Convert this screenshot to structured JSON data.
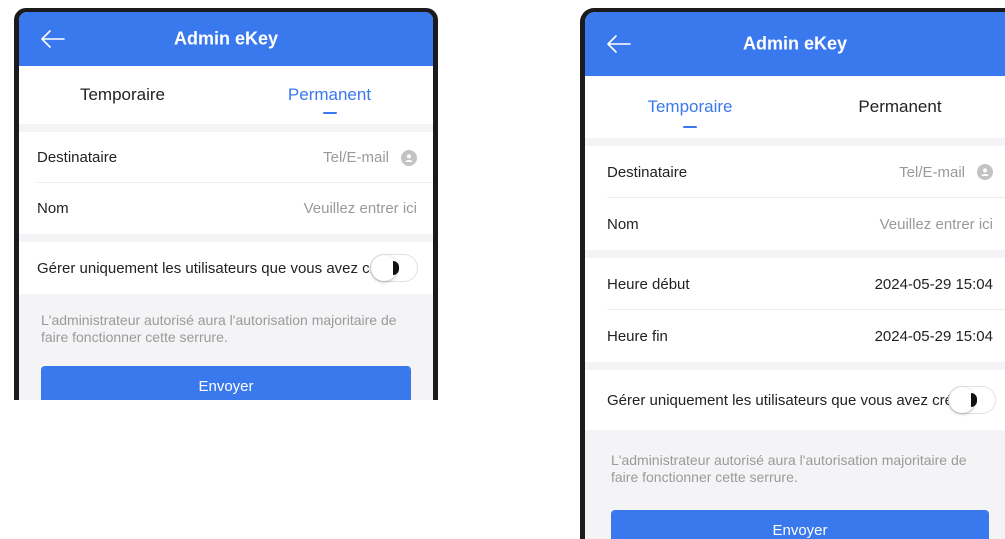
{
  "screens": [
    {
      "header": {
        "title": "Admin eKey"
      },
      "tabs": [
        {
          "label": "Temporaire"
        },
        {
          "label": "Permanent"
        }
      ],
      "active_tab": "Permanent",
      "fields": {
        "recipient": {
          "label": "Destinataire",
          "placeholder": "Tel/E-mail"
        },
        "name": {
          "label": "Nom",
          "placeholder": "Veuillez entrer ici"
        }
      },
      "toggle": {
        "label": "Gérer uniquement les utilisateurs que vous avez créés"
      },
      "note": "L'administrateur autorisé aura l'autorisation majoritaire de faire fonctionner cette serrure.",
      "send_label": "Envoyer"
    },
    {
      "header": {
        "title": "Admin eKey"
      },
      "tabs": [
        {
          "label": "Temporaire"
        },
        {
          "label": "Permanent"
        }
      ],
      "active_tab": "Temporaire",
      "fields": {
        "recipient": {
          "label": "Destinataire",
          "placeholder": "Tel/E-mail"
        },
        "name": {
          "label": "Nom",
          "placeholder": "Veuillez entrer ici"
        },
        "start": {
          "label": "Heure début",
          "value": "2024-05-29 15:04"
        },
        "end": {
          "label": "Heure fin",
          "value": "2024-05-29 15:04"
        }
      },
      "toggle": {
        "label": "Gérer uniquement les utilisateurs que vous avez créés"
      },
      "note": "L'administrateur autorisé aura l'autorisation majoritaire de faire fonctionner cette serrure.",
      "send_label": "Envoyer"
    }
  ],
  "colors": {
    "primary": "#3a78ee",
    "background": "#f4f4f6",
    "placeholder": "#9a9a9a"
  }
}
